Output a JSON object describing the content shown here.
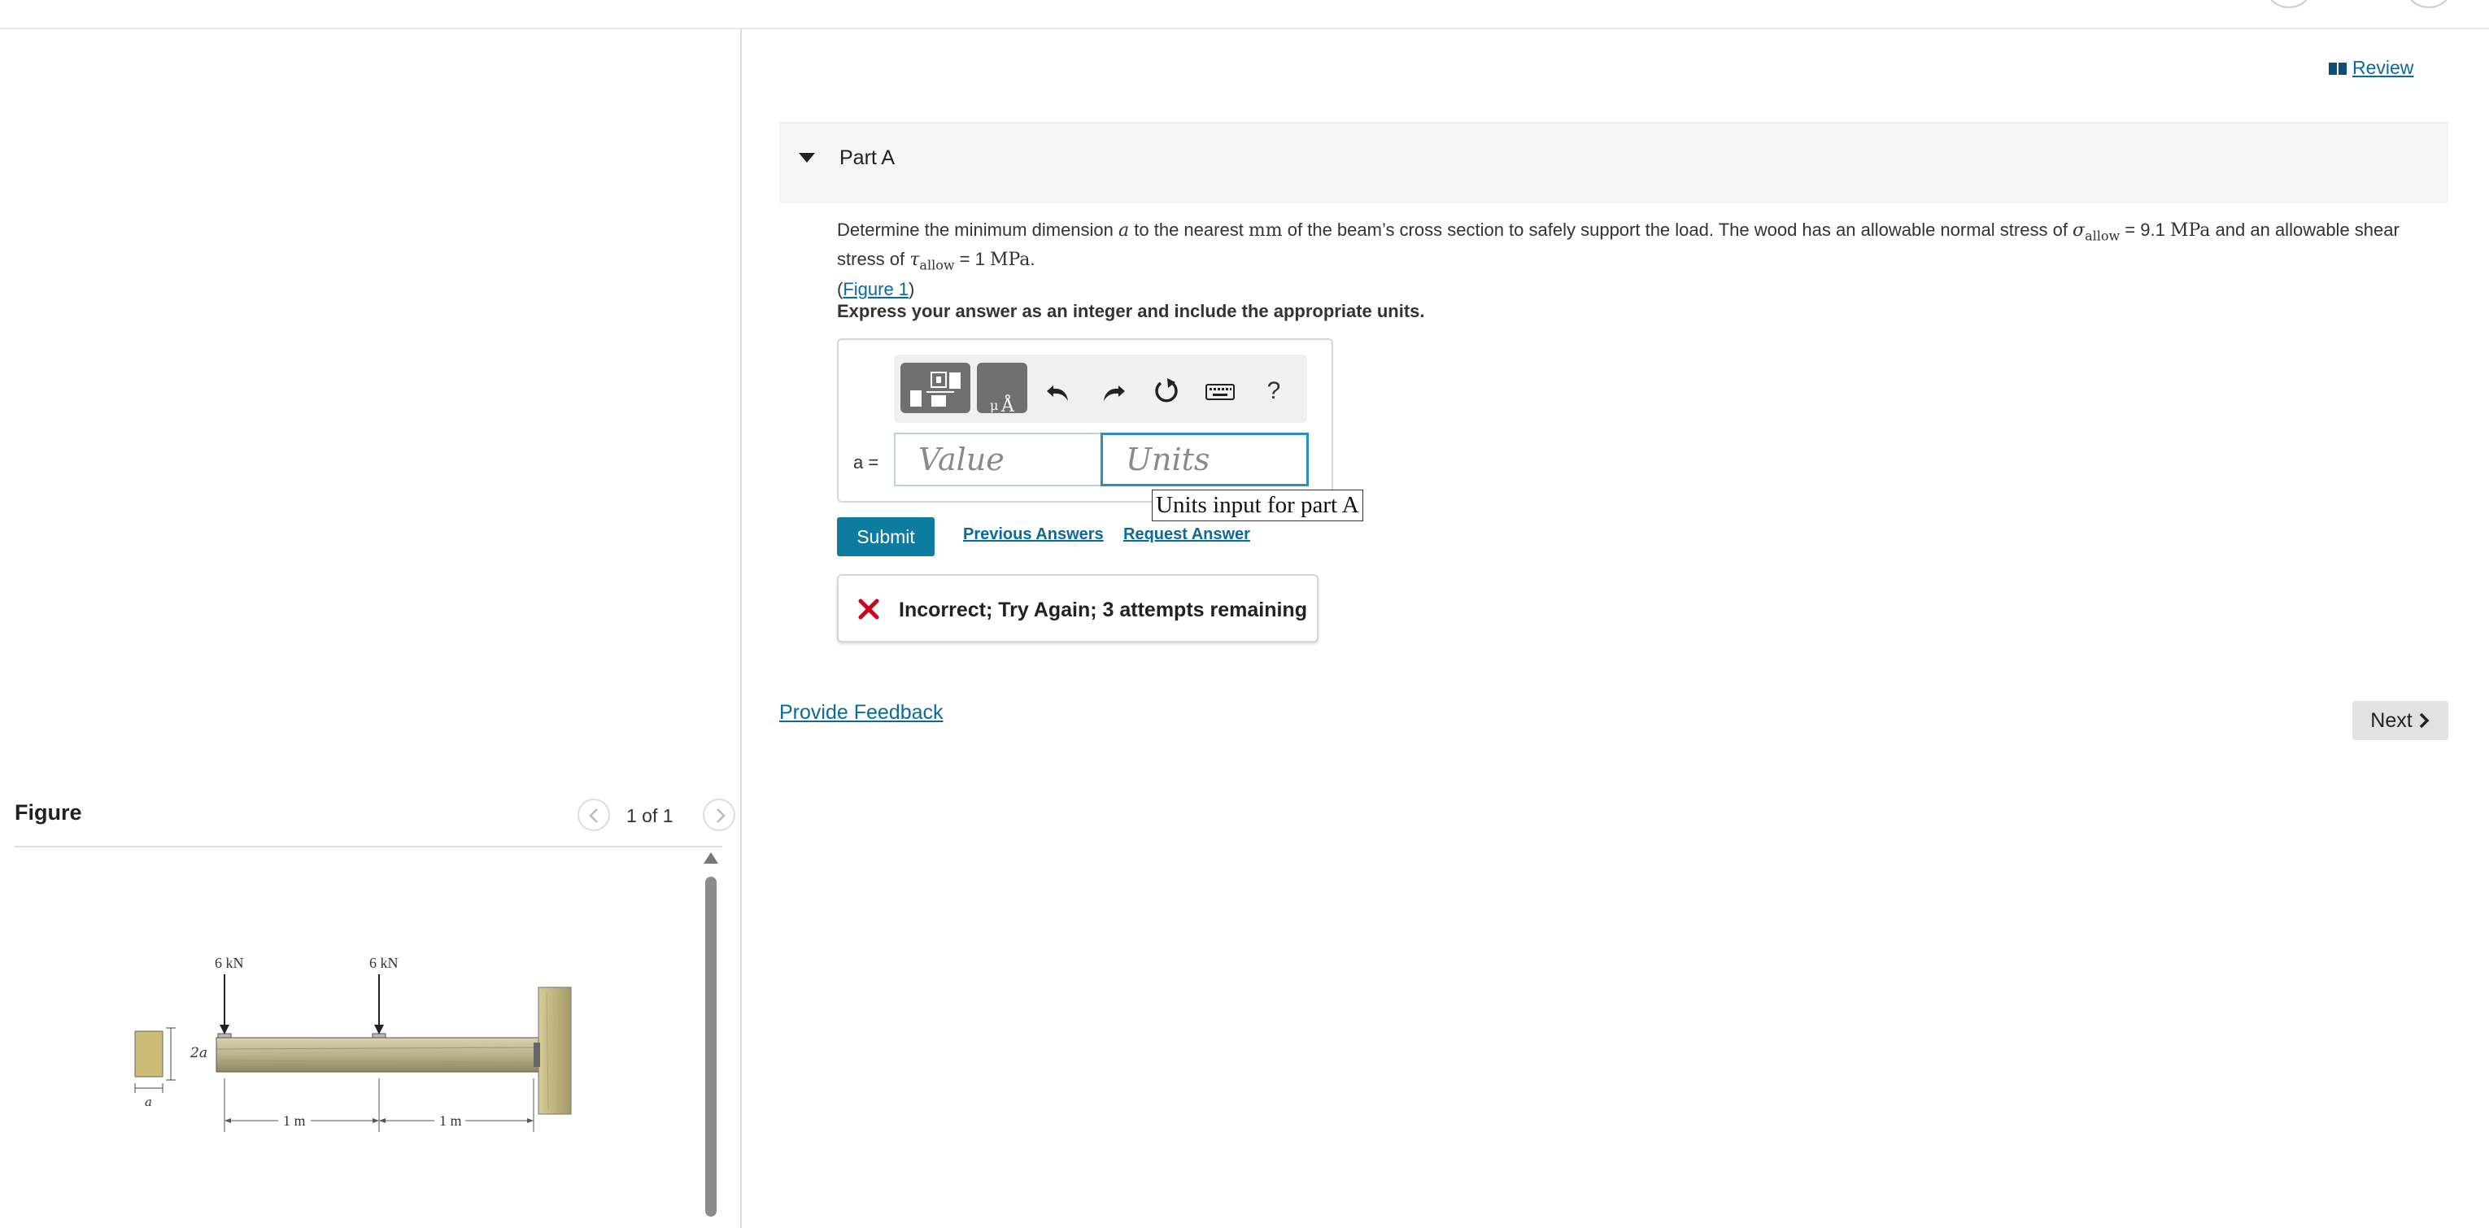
{
  "review": {
    "label": "Review"
  },
  "part": {
    "title": "Part A"
  },
  "problem": {
    "text_1": "Determine the minimum dimension ",
    "var_a": "a",
    "text_2": " to the nearest ",
    "unit_mm": "mm",
    "text_3": " of the beam’s cross section to safely support the load. The wood has an allowable normal stress of ",
    "sigma": "σ",
    "sub_allow": "allow",
    "text_4": " = 9.1 ",
    "unit_mpa": "MPa",
    "text_5": " and an allowable shear stress of ",
    "tau": "τ",
    "sub_allow2": "allow",
    "text_6": " = 1 ",
    "unit_mpa2": "MPa",
    "text_7": ".",
    "figure_link": "Figure 1",
    "paren_open": "(",
    "paren_close": ")"
  },
  "instruction": "Express your answer as an integer and include the appropriate units.",
  "answer": {
    "variable_label": "a =",
    "value_placeholder": "Value",
    "units_placeholder": "Units",
    "units_tooltip": "Units input for part A",
    "help_label": "?"
  },
  "actions": {
    "submit": "Submit",
    "previous_answers": "Previous Answers",
    "request_answer": "Request Answer"
  },
  "feedback": {
    "message": "Incorrect; Try Again; 3 attempts remaining"
  },
  "footer": {
    "provide_feedback": "Provide Feedback",
    "next": "Next"
  },
  "figure_panel": {
    "title": "Figure",
    "pager": "1 of 1",
    "load_1": "6 kN",
    "load_2": "6 kN",
    "dim_height": "2a",
    "dim_width": "a",
    "span_1": "1 m",
    "span_2": "1 m"
  },
  "colors": {
    "link": "#0b6a9a",
    "submit_bg": "#0e7c9e",
    "error_red": "#d0021b",
    "units_focus": "#2d8fbd"
  }
}
